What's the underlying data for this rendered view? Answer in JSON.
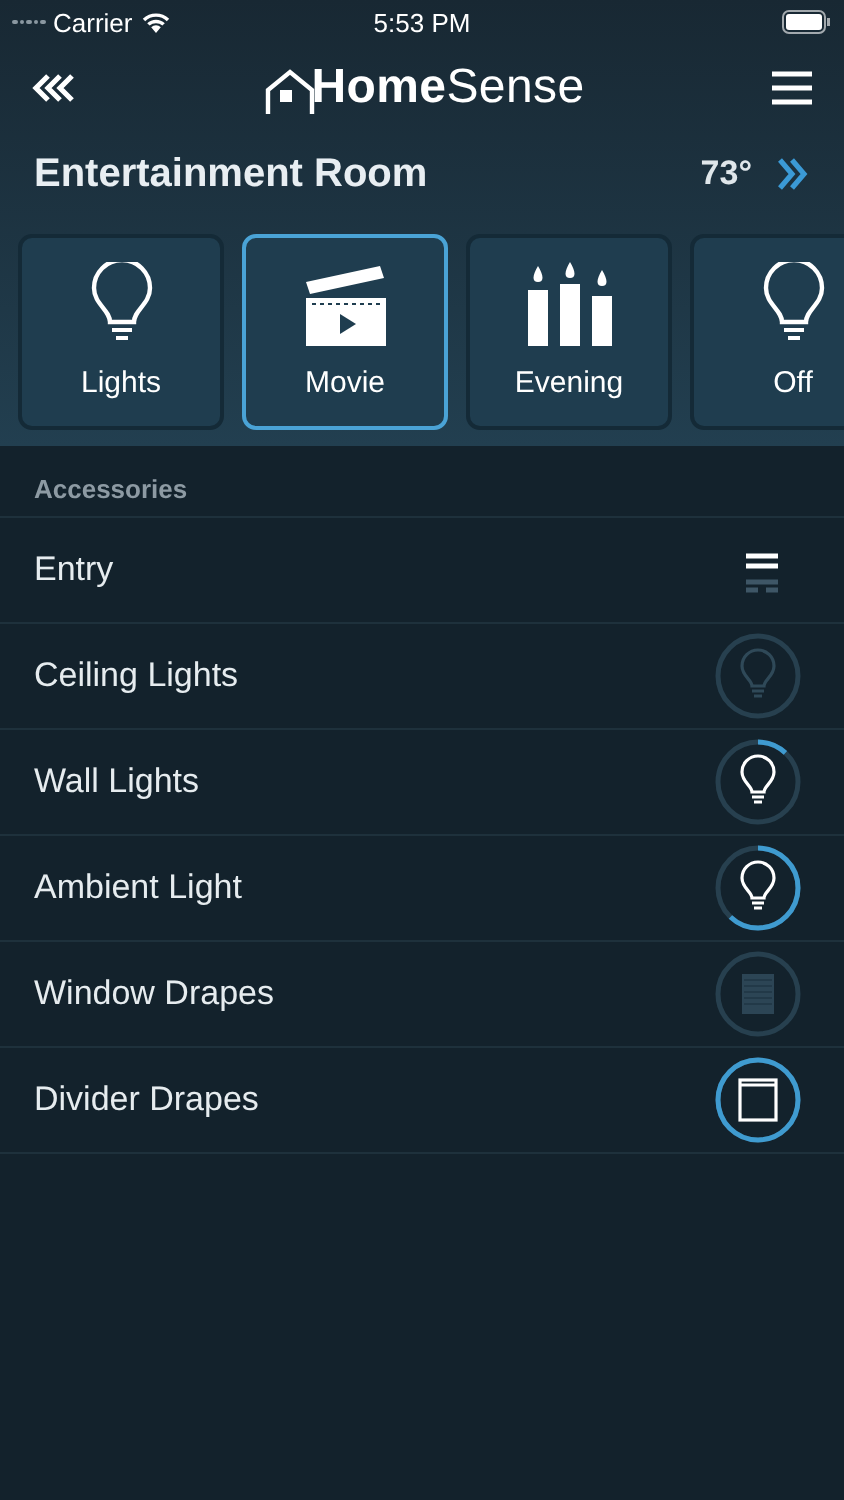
{
  "status_bar": {
    "carrier": "Carrier",
    "time": "5:53 PM"
  },
  "header": {
    "logo_bold": "Home",
    "logo_light": "Sense"
  },
  "room": {
    "name": "Entertainment Room",
    "temperature": "73°"
  },
  "scenes": [
    {
      "label": "Lights",
      "kind": "bulb",
      "selected": false
    },
    {
      "label": "Movie",
      "kind": "clapper",
      "selected": true
    },
    {
      "label": "Evening",
      "kind": "candles",
      "selected": false
    },
    {
      "label": "Off",
      "kind": "bulb",
      "selected": false
    }
  ],
  "accessories_heading": "Accessories",
  "accessories": [
    {
      "name": "Entry",
      "kind": "door"
    },
    {
      "name": "Ceiling Lights",
      "kind": "light",
      "on": false
    },
    {
      "name": "Wall Lights",
      "kind": "light",
      "on": true,
      "level": 0.12
    },
    {
      "name": "Ambient Light",
      "kind": "light",
      "on": true,
      "level": 0.62
    },
    {
      "name": "Window Drapes",
      "kind": "drape",
      "on": false
    },
    {
      "name": "Divider Drapes",
      "kind": "drape",
      "on": true,
      "level": 1
    }
  ]
}
